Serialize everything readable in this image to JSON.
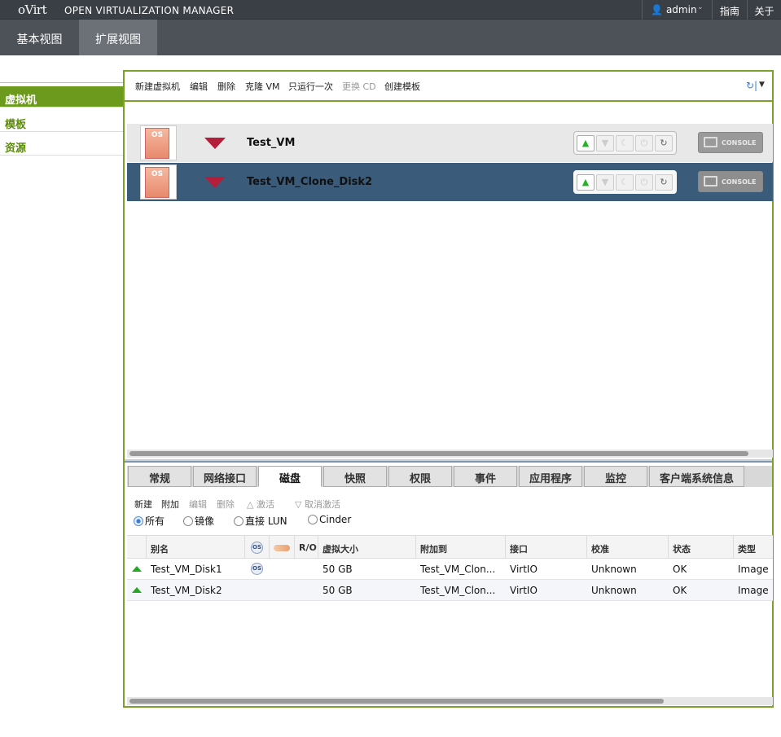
{
  "header": {
    "logo": "oVirt",
    "product": "OPEN VIRTUALIZATION MANAGER",
    "user": "admin",
    "guide": "指南",
    "about": "关于"
  },
  "views": {
    "basic": "基本视图",
    "extended": "扩展视图"
  },
  "nav": {
    "vm": "虚拟机",
    "templates": "模板",
    "resources": "资源"
  },
  "toolbar": {
    "new_vm": "新建虚拟机",
    "edit": "编辑",
    "delete": "删除",
    "clone_vm": "克隆 VM",
    "run_once": "只运行一次",
    "change_cd": "更换 CD",
    "create_template": "创建模板"
  },
  "vms": [
    {
      "name": "Test_VM",
      "status": "down",
      "os_label": "OS",
      "console_label": "CONSOLE"
    },
    {
      "name": "Test_VM_Clone_Disk2",
      "status": "down",
      "os_label": "OS",
      "console_label": "CONSOLE"
    }
  ],
  "subtabs": [
    "常规",
    "网络接口",
    "磁盘",
    "快照",
    "权限",
    "事件",
    "应用程序",
    "监控",
    "客户端系统信息"
  ],
  "disk_actions": {
    "new": "新建",
    "attach": "附加",
    "edit": "编辑",
    "delete": "删除",
    "activate": "激活",
    "deactivate": "取消激活"
  },
  "disk_filter": {
    "all": "所有",
    "image": "镜像",
    "direct_lun": "直接 LUN",
    "cinder": "Cinder",
    "selected": "all"
  },
  "disk_table": {
    "columns": [
      "别名",
      "OS",
      "",
      "R/O",
      "虚拟大小",
      "附加到",
      "接口",
      "校准",
      "状态",
      "类型"
    ],
    "rows": [
      {
        "alias": "Test_VM_Disk1",
        "bootable": "OS",
        "size": "50 GB",
        "attached_to": "Test_VM_Clon...",
        "interface": "VirtIO",
        "alignment": "Unknown",
        "status": "OK",
        "type": "Image"
      },
      {
        "alias": "Test_VM_Disk2",
        "bootable": "",
        "size": "50 GB",
        "attached_to": "Test_VM_Clon...",
        "interface": "VirtIO",
        "alignment": "Unknown",
        "status": "OK",
        "type": "Image"
      }
    ]
  },
  "colors": {
    "accent_green": "#7ba12a",
    "header_bg": "#393f44",
    "selected_row": "#3b5b7a",
    "status_down": "#b51e3a",
    "status_up": "#22a822"
  }
}
